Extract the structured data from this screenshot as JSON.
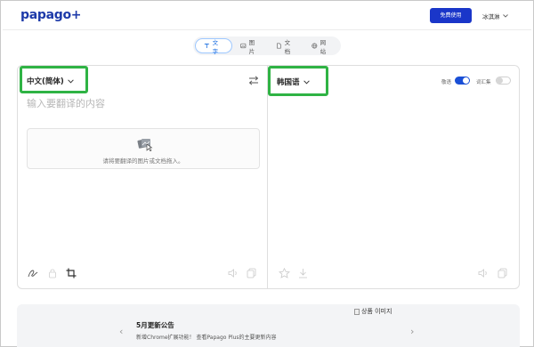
{
  "header": {
    "logo": "papago+",
    "free_button": "免费使用",
    "user_name": "冰淇淋"
  },
  "tabs": [
    {
      "label": "文字",
      "icon": "text-icon",
      "active": true
    },
    {
      "label": "图片",
      "icon": "image-icon",
      "active": false
    },
    {
      "label": "文档",
      "icon": "document-icon",
      "active": false
    },
    {
      "label": "网站",
      "icon": "globe-icon",
      "active": false
    }
  ],
  "source": {
    "language": "中文(简体)",
    "placeholder": "输入要翻译的内容",
    "drop_text": "请将要翻译的图片或文档拖入。"
  },
  "target": {
    "language": "韩国语",
    "honorific_label": "敬语",
    "honorific_on": true,
    "glossary_label": "词汇集",
    "glossary_on": false
  },
  "banner": {
    "title": "5月更新公告",
    "subtitle": "新增Chrome扩展功能！ 查看Papago Plus的主要更新内容",
    "image_alt": "상품 이미지"
  },
  "colors": {
    "brand": "#1d3aa9",
    "primary_button": "#1a36c9",
    "highlight_box": "#2fb344",
    "toggle_on": "#1a4fd6"
  }
}
